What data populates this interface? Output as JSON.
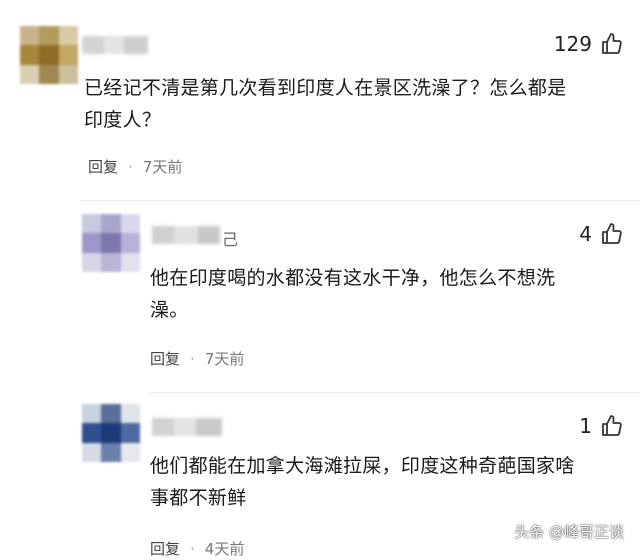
{
  "comments": [
    {
      "likes": "129",
      "text_line1": "已经记不清是第几次看到印度人在景区洗澡了？怎么都是",
      "text_line2": "印度人？",
      "reply_label": "回复",
      "time": "7天前"
    },
    {
      "likes": "4",
      "name_suffix": "己",
      "text_line1": "他在印度喝的水都没有这水干净，他怎么不想洗",
      "text_line2": "澡。",
      "reply_label": "回复",
      "time": "7天前"
    },
    {
      "likes": "1",
      "text_line1": "他们都能在加拿大海滩拉屎，印度这种奇葩国家啥",
      "text_line2": "事都不新鲜",
      "reply_label": "回复",
      "time": "4天前"
    }
  ],
  "watermark": "头条 @峰哥正谈",
  "icons": {
    "like": "thumbs-up-icon",
    "dot": "separator-dot"
  },
  "colors": {
    "background": "#ffffff",
    "text": "#1a1a1a",
    "meta": "#777777"
  }
}
